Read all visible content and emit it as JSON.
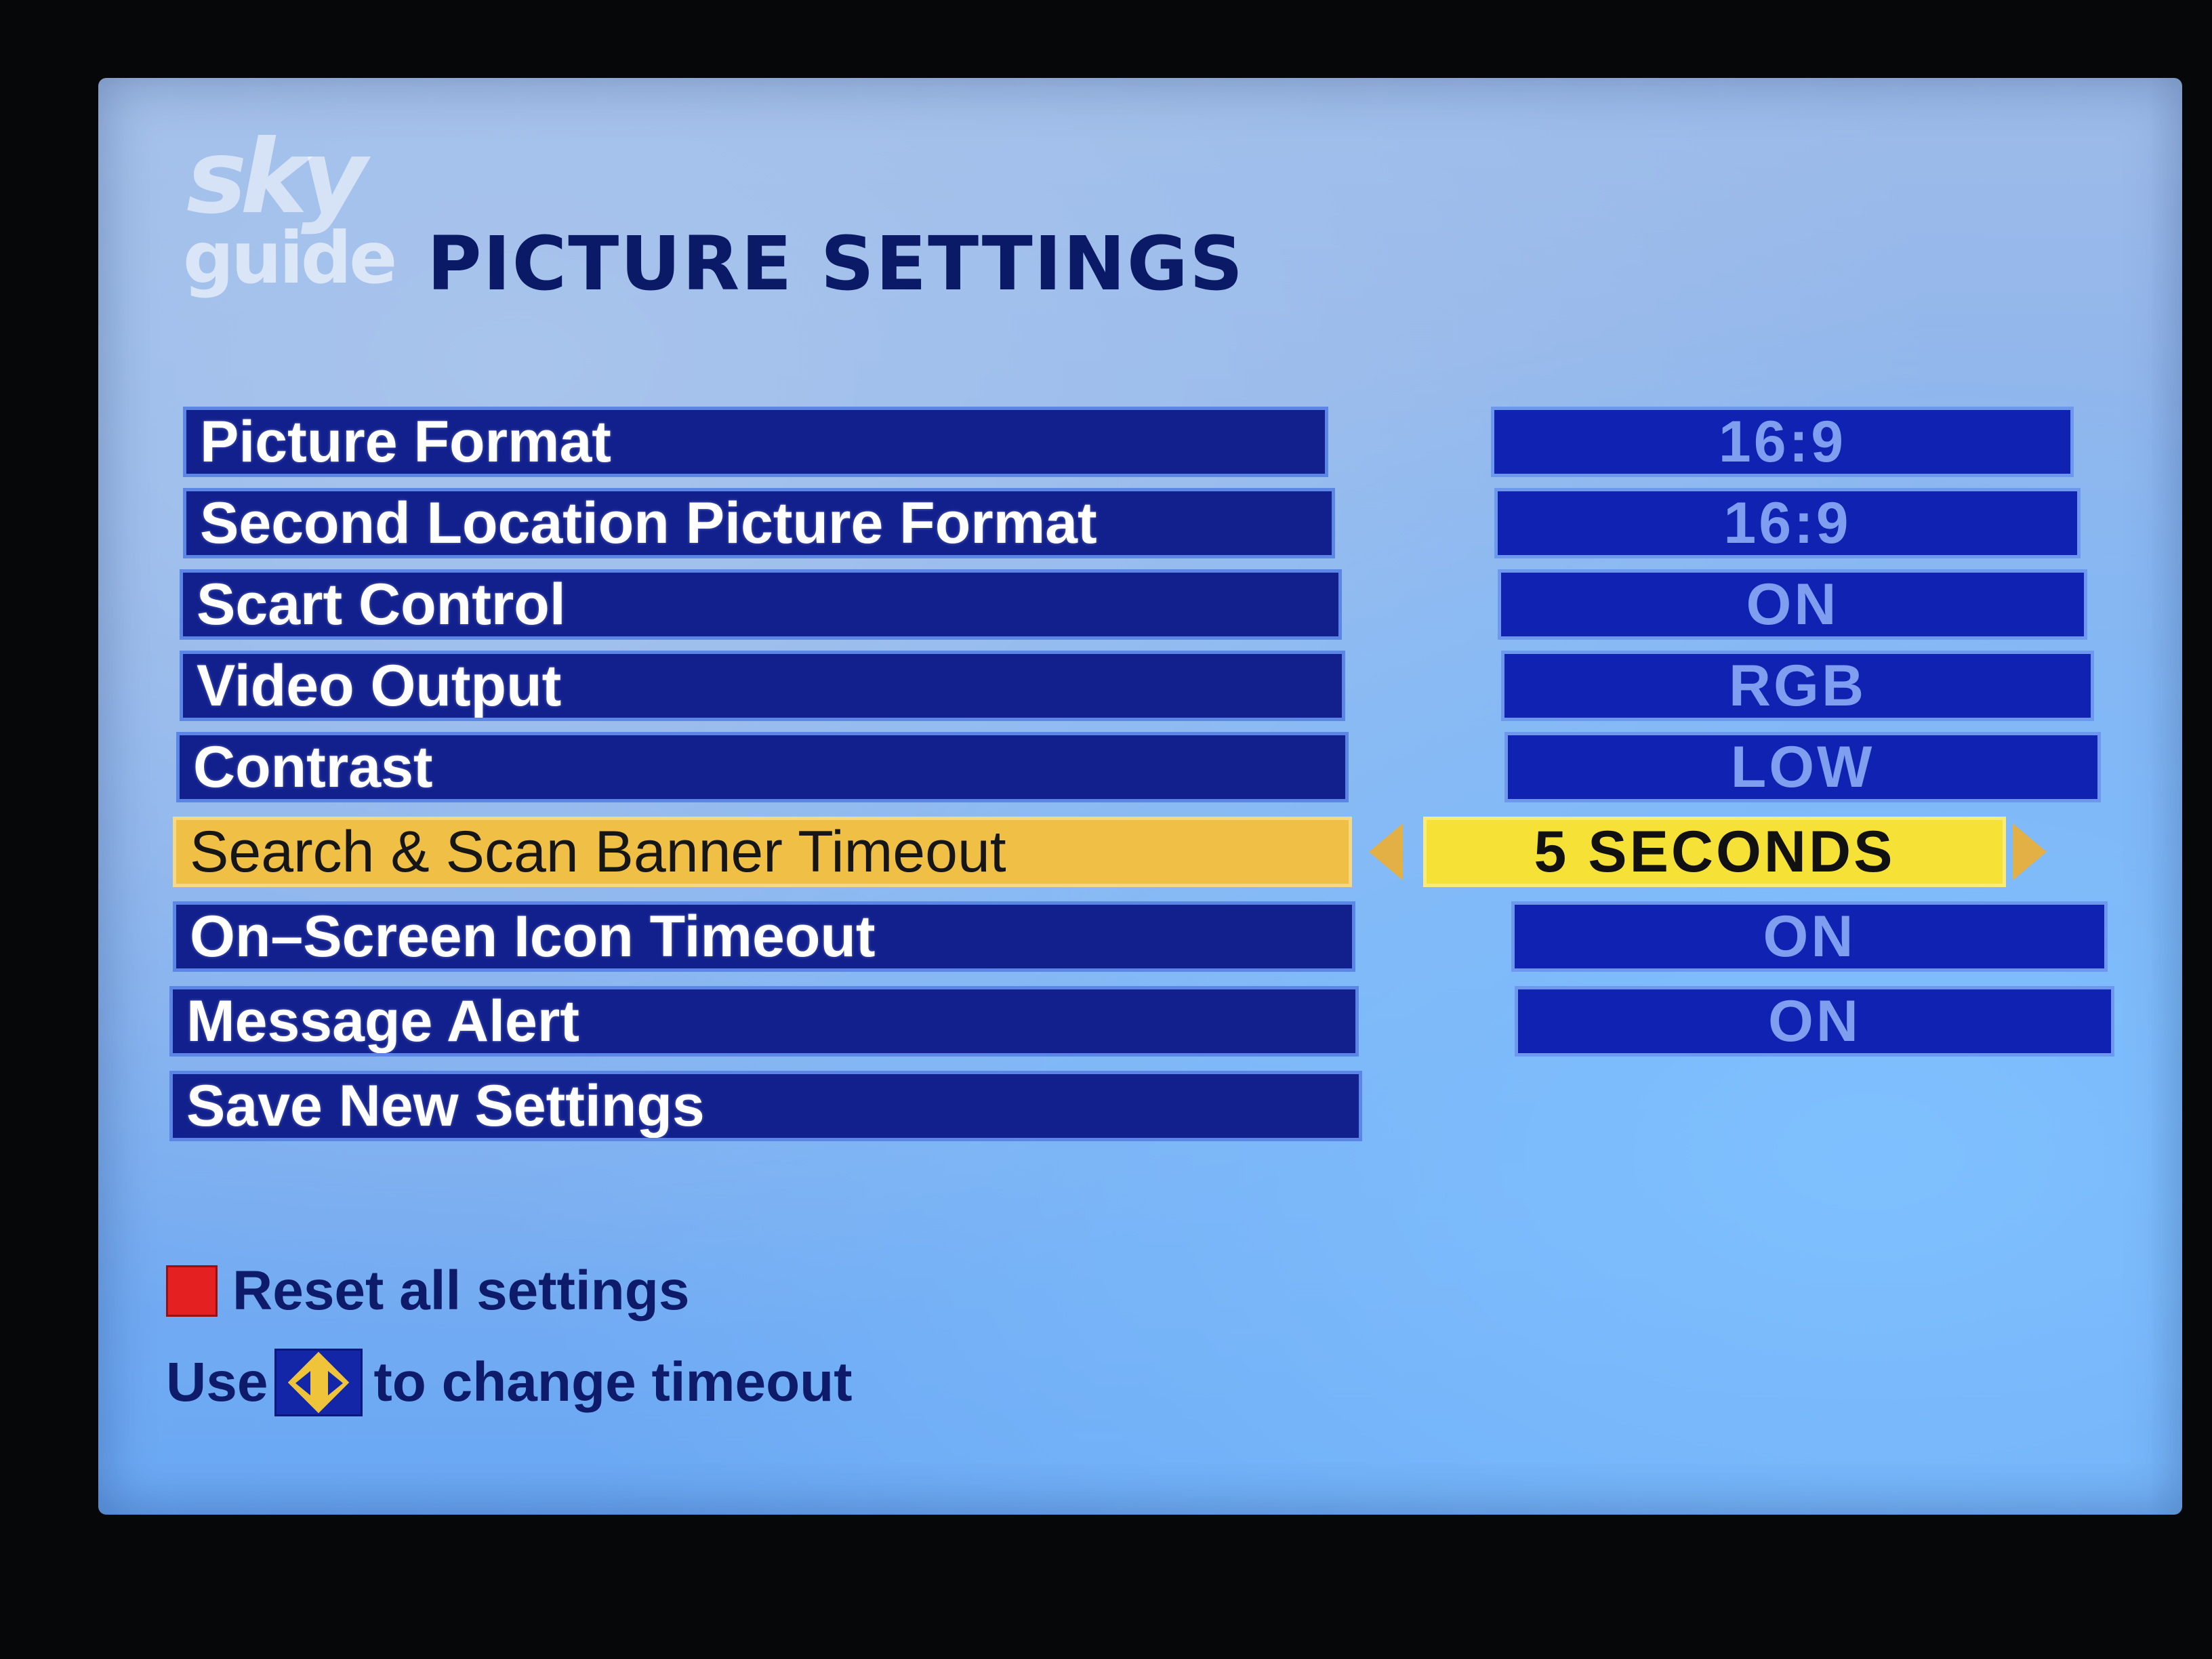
{
  "logo": {
    "brand": "sky",
    "sub": "guide"
  },
  "page_title": "PICTURE SETTINGS",
  "settings": [
    {
      "label": "Picture Format",
      "value": "16:9"
    },
    {
      "label": "Second Location Picture Format",
      "value": "16:9"
    },
    {
      "label": "Scart Control",
      "value": "ON"
    },
    {
      "label": "Video Output",
      "value": "RGB"
    },
    {
      "label": "Contrast",
      "value": "LOW"
    },
    {
      "label": "Search & Scan Banner Timeout",
      "value": "5 SECONDS",
      "selected": true
    },
    {
      "label": "On–Screen Icon Timeout",
      "value": "ON"
    },
    {
      "label": "Message Alert",
      "value": "ON"
    },
    {
      "label": "Save New Settings"
    }
  ],
  "footer": {
    "reset_label": "Reset all settings",
    "hint_prefix": "Use",
    "hint_suffix": "to change timeout"
  },
  "icons": {
    "reset_key": "red-button-icon",
    "change_key": "left-right-arrows-icon",
    "selector_arrows": "chevron-left-right-icon"
  },
  "colors": {
    "screen_background": "#86b1ee",
    "row_background": "#12208e",
    "value_background": "#0f22b2",
    "value_text": "#7f9ef0",
    "selected_label_background": "#f0bf45",
    "selected_value_background": "#f6e236",
    "title_text": "#0a1a66",
    "red_key": "#e52020"
  }
}
